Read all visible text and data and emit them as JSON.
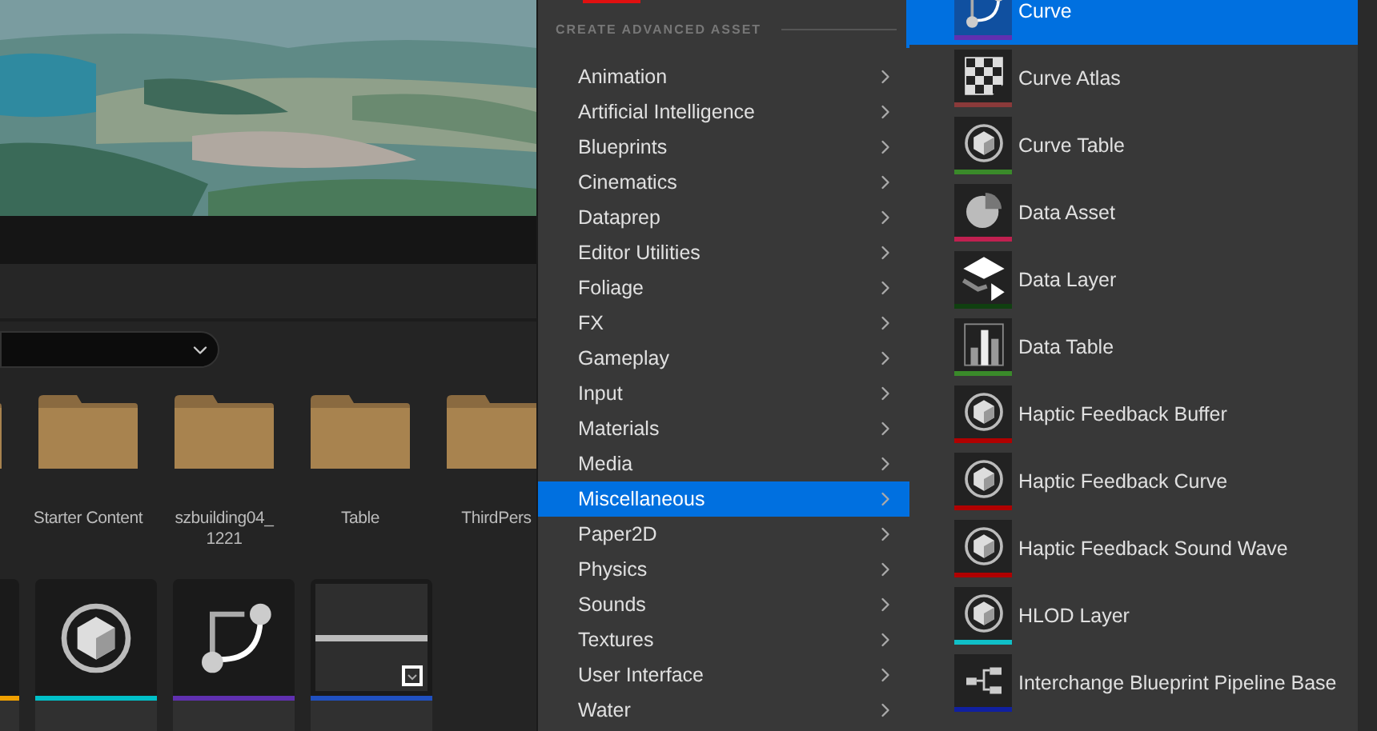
{
  "content_browser": {
    "folders": [
      {
        "kind": "folder"
      },
      {
        "kind": "folder",
        "name": "Starter Content"
      },
      {
        "kind": "folder",
        "name": "szbuilding04_ 1221"
      },
      {
        "kind": "folder",
        "name": "Table"
      },
      {
        "kind": "folder",
        "name": "ThirdPers"
      }
    ],
    "assets": [
      {
        "kind": "blank",
        "color": "#f0a000"
      },
      {
        "kind": "cube",
        "color": "#00c0c8"
      },
      {
        "kind": "curve",
        "color": "#6030b0"
      },
      {
        "kind": "widget",
        "color": "#2050c0"
      }
    ]
  },
  "menu": {
    "header": "CREATE ADVANCED ASSET",
    "items": [
      {
        "label": "Animation",
        "selected": false
      },
      {
        "label": "Artificial Intelligence",
        "selected": false
      },
      {
        "label": "Blueprints",
        "selected": false
      },
      {
        "label": "Cinematics",
        "selected": false
      },
      {
        "label": "Dataprep",
        "selected": false
      },
      {
        "label": "Editor Utilities",
        "selected": false
      },
      {
        "label": "Foliage",
        "selected": false
      },
      {
        "label": "FX",
        "selected": false
      },
      {
        "label": "Gameplay",
        "selected": false
      },
      {
        "label": "Input",
        "selected": false
      },
      {
        "label": "Materials",
        "selected": false
      },
      {
        "label": "Media",
        "selected": false
      },
      {
        "label": "Miscellaneous",
        "selected": true
      },
      {
        "label": "Paper2D",
        "selected": false
      },
      {
        "label": "Physics",
        "selected": false
      },
      {
        "label": "Sounds",
        "selected": false
      },
      {
        "label": "Textures",
        "selected": false
      },
      {
        "label": "User Interface",
        "selected": false
      },
      {
        "label": "Water",
        "selected": false
      }
    ]
  },
  "submenu": {
    "items": [
      {
        "label": "Curve",
        "kind": "curve",
        "color": "#6030b0",
        "selected": true
      },
      {
        "label": "Curve Atlas",
        "kind": "checker",
        "color": "#8a3a3a",
        "selected": false
      },
      {
        "label": "Curve Table",
        "kind": "cube",
        "color": "#3a8a2a",
        "selected": false
      },
      {
        "label": "Data Asset",
        "kind": "pie",
        "color": "#c02050",
        "selected": false
      },
      {
        "label": "Data Layer",
        "kind": "layer",
        "color": "#104010",
        "selected": false
      },
      {
        "label": "Data Table",
        "kind": "bars",
        "color": "#3a8a2a",
        "selected": false
      },
      {
        "label": "Haptic Feedback Buffer",
        "kind": "cube",
        "color": "#b00000",
        "selected": false
      },
      {
        "label": "Haptic Feedback Curve",
        "kind": "cube",
        "color": "#b00000",
        "selected": false
      },
      {
        "label": "Haptic Feedback Sound Wave",
        "kind": "cube",
        "color": "#b00000",
        "selected": false
      },
      {
        "label": "HLOD Layer",
        "kind": "cube",
        "color": "#10c0c8",
        "selected": false
      },
      {
        "label": "Interchange Blueprint Pipeline Base",
        "kind": "tree",
        "color": "#1020a0",
        "selected": false
      }
    ]
  }
}
